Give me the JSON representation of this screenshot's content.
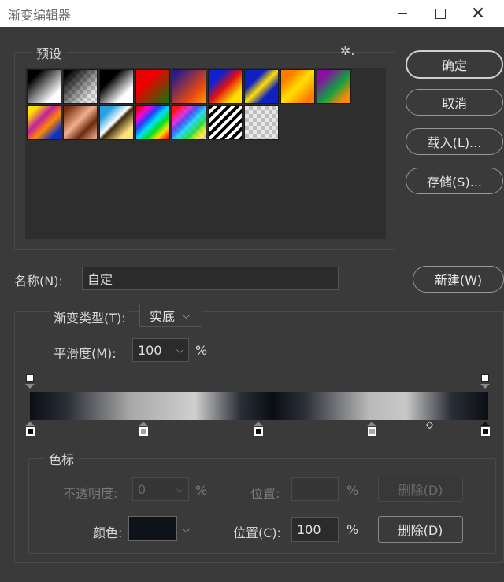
{
  "window": {
    "title": "渐变编辑器",
    "close_glyph": "✕"
  },
  "presets": {
    "legend": "预设",
    "menu_icon": "gear-icon",
    "menu_glyph": "✲.",
    "swatches": [
      {
        "name": "foreground-to-background"
      },
      {
        "name": "foreground-to-transparent"
      },
      {
        "name": "black-white"
      },
      {
        "name": "red-green"
      },
      {
        "name": "violet-orange"
      },
      {
        "name": "blue-red-yellow"
      },
      {
        "name": "blue-yellow-blue"
      },
      {
        "name": "orange-yellow-orange"
      },
      {
        "name": "violet-green-orange"
      },
      {
        "name": "yellow-violet-orange-blue"
      },
      {
        "name": "copper"
      },
      {
        "name": "chrome"
      },
      {
        "name": "spectrum"
      },
      {
        "name": "transparent-rainbow"
      },
      {
        "name": "transparent-stripes"
      },
      {
        "name": "transparent"
      }
    ]
  },
  "buttons": {
    "ok": "确定",
    "cancel": "取消",
    "load": "载入(L)...",
    "save": "存储(S)...",
    "new": "新建(W)"
  },
  "name_field": {
    "label": "名称(N):",
    "value": "自定"
  },
  "gradient_type": {
    "label": "渐变类型(T):",
    "value": "实底"
  },
  "smoothness": {
    "label": "平滑度(M):",
    "value": "100",
    "unit": "%"
  },
  "gradient": {
    "opacity_stops": [
      0,
      100
    ],
    "color_stops": [
      {
        "location": 0,
        "color": "#0b0e15",
        "selected": false
      },
      {
        "location": 25,
        "color": "#a0a0a0",
        "selected": false
      },
      {
        "location": 50,
        "color": "#0b0e15",
        "selected": false
      },
      {
        "location": 75,
        "color": "#a8a8a8",
        "selected": false
      },
      {
        "location": 100,
        "color": "#0b0e15",
        "selected": true
      }
    ]
  },
  "stops_group": {
    "legend": "色标",
    "opacity_label": "不透明度:",
    "opacity_value": "0",
    "opacity_unit": "%",
    "position_label_top": "位置:",
    "position_top_value": "",
    "position_top_unit": "%",
    "delete_top": "删除(D)",
    "color_label": "颜色:",
    "color_value": "#0e1219",
    "position_label_bottom": "位置(C):",
    "position_bottom_value": "100",
    "position_bottom_unit": "%",
    "delete_bottom": "删除(D)"
  }
}
